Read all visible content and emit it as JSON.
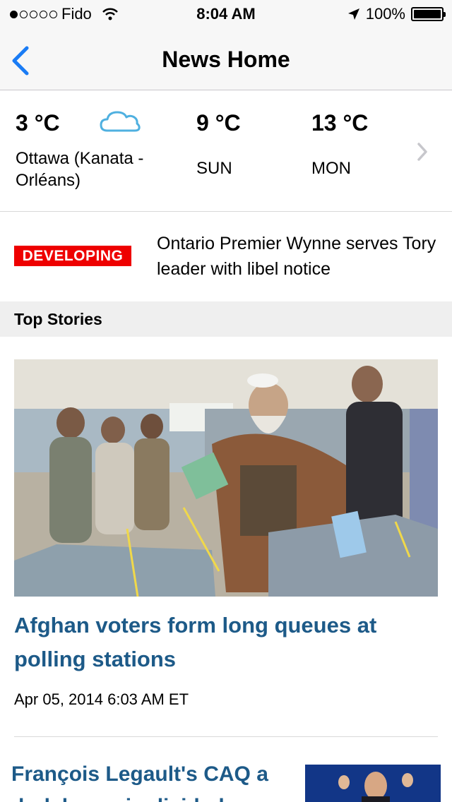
{
  "status_bar": {
    "carrier": "Fido",
    "time": "8:04 AM",
    "battery": "100%"
  },
  "nav": {
    "title": "News Home",
    "back_icon": "chevron-left-icon"
  },
  "weather": {
    "current": {
      "temp": "3 °C",
      "location": "Ottawa (Kanata - Orléans)",
      "icon": "cloud-icon"
    },
    "forecast": [
      {
        "temp": "9 °C",
        "day": "SUN"
      },
      {
        "temp": "13 °C",
        "day": "MON"
      }
    ],
    "more_icon": "chevron-right-icon"
  },
  "developing": {
    "badge": "DEVELOPING",
    "headline": "Ontario Premier Wynne serves Tory leader with libel notice"
  },
  "section": {
    "title": "Top Stories"
  },
  "stories": [
    {
      "headline": "Afghan voters form long queues at polling stations",
      "timestamp": "Apr 05, 2014 6:03 AM ET"
    },
    {
      "headline": "François Legault's CAQ a dark horse in divided"
    }
  ],
  "colors": {
    "accent": "#1a7cf5",
    "headline": "#1d5a88",
    "badge": "#ee0000"
  }
}
